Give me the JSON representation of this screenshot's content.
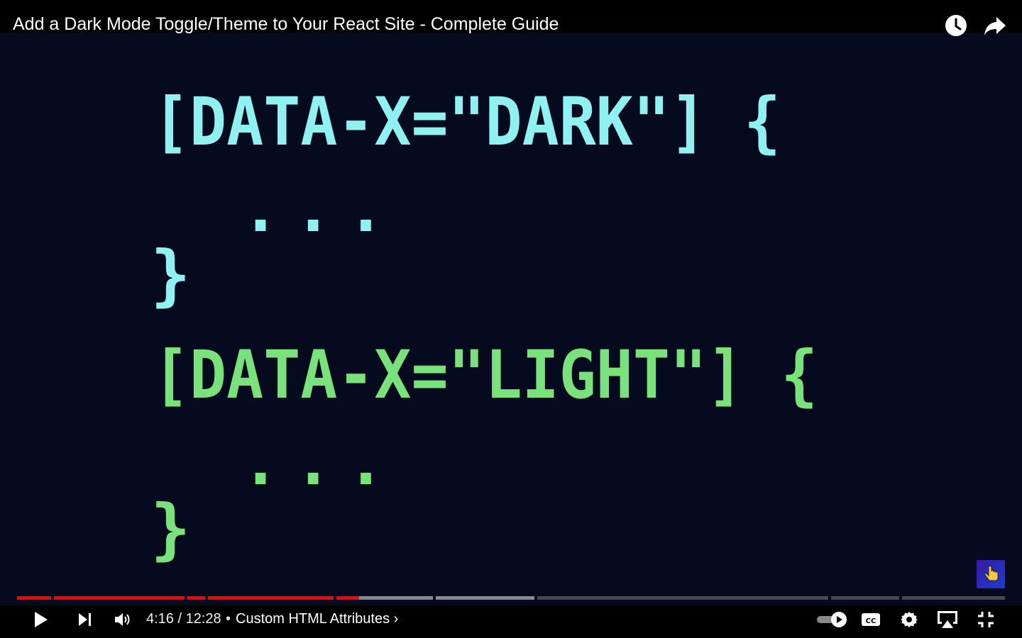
{
  "video": {
    "title": "Add a Dark Mode Toggle/Theme to Your React Site - Complete Guide"
  },
  "slide": {
    "line1": "[DATA-X=\"DARK\"] {",
    "line2": "...",
    "line3": "}",
    "line4": "[DATA-X=\"LIGHT\"] {",
    "line5": "...",
    "line6": "}",
    "dark_text_color": "#8ff2f0",
    "light_text_color": "#79e27b",
    "background_color": "#050a1e"
  },
  "player": {
    "current_time": "4:16",
    "duration": "12:28",
    "time_display": "4:16 / 12:28",
    "separator": "•",
    "chapter_label": "Custom HTML Attributes",
    "chapter_chevron": "›",
    "progress_played_fraction": 0.34,
    "colors": {
      "played": "#ff0000",
      "buffered": "#8a8a8a",
      "unplayed": "#4a4a4a"
    }
  },
  "icons": {
    "watch_later": "clock-icon",
    "share": "share-icon",
    "play": "play-icon",
    "next": "next-icon",
    "volume": "volume-icon",
    "autoplay": "autoplay-toggle-icon",
    "captions": "cc-icon",
    "settings": "gear-icon",
    "airplay": "airplay-icon",
    "exit_fullscreen": "exit-fullscreen-icon",
    "cursor": "hand-pointer-icon"
  }
}
